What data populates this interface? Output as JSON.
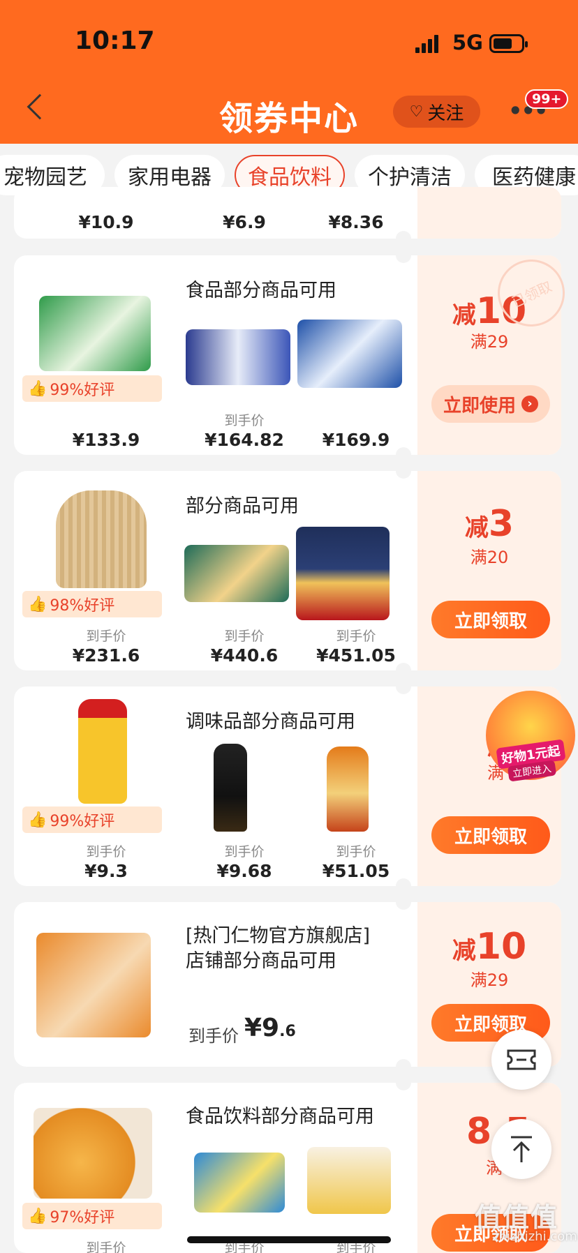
{
  "status": {
    "time": "10:17",
    "network": "5G"
  },
  "header": {
    "title": "领券中心",
    "follow": "关注",
    "badge": "99+",
    "more": "•••"
  },
  "tabs": [
    {
      "label": "宠物园艺",
      "active": false
    },
    {
      "label": "家用电器",
      "active": false
    },
    {
      "label": "食品饮料",
      "active": true
    },
    {
      "label": "个护清洁",
      "active": false
    },
    {
      "label": "医药健康",
      "active": false
    }
  ],
  "card0": {
    "prices": [
      "¥10.9",
      "¥6.9",
      "¥8.36"
    ]
  },
  "card1": {
    "heading": "食品部分商品可用",
    "rating": "99%好评",
    "daoshou": "到手价",
    "prices": [
      "¥133.9",
      "¥164.82",
      "¥169.9"
    ],
    "disc_prefix": "减",
    "disc_value": "10",
    "cond": "满29",
    "button": "立即使用",
    "stamp": "已领取"
  },
  "card2": {
    "heading": "部分商品可用",
    "rating": "98%好评",
    "daoshou": [
      "到手价",
      "到手价",
      "到手价"
    ],
    "prices": [
      "¥231.6",
      "¥440.6",
      "¥451.05"
    ],
    "disc_prefix": "减",
    "disc_value": "3",
    "cond": "满20",
    "button": "立即领取"
  },
  "card3": {
    "heading": "调味品部分商品可用",
    "rating": "99%好评",
    "daoshou": [
      "到手价",
      "到手价",
      "到手价"
    ],
    "prices": [
      "¥9.3",
      "¥9.68",
      "¥51.05"
    ],
    "disc_prefix": "减",
    "cond": "满",
    "button": "立即领取",
    "promo": {
      "title": "好物1元起",
      "sub": "立即进入"
    }
  },
  "card4": {
    "heading_line1": "[热门仁物官方旗舰店]",
    "heading_line2": "店铺部分商品可用",
    "daoshou": "到手价",
    "price_int": "¥9",
    "price_dec": ".6",
    "disc_prefix": "减",
    "disc_value": "10",
    "cond": "满29",
    "button": "立即领取"
  },
  "card5": {
    "heading": "食品饮料部分商品可用",
    "rating": "97%好评",
    "daoshou": [
      "到手价",
      "到手价",
      "到手价"
    ],
    "disc_value": "8.5",
    "cond": "满9",
    "button": "立即领取"
  },
  "watermark": {
    "main": "值值值",
    "sub": "zhizhizhi.com"
  },
  "colors": {
    "header": "#ff6a1f",
    "accent": "#e8422a",
    "button": "#ff6a1f",
    "background": "#f3f3f3"
  }
}
